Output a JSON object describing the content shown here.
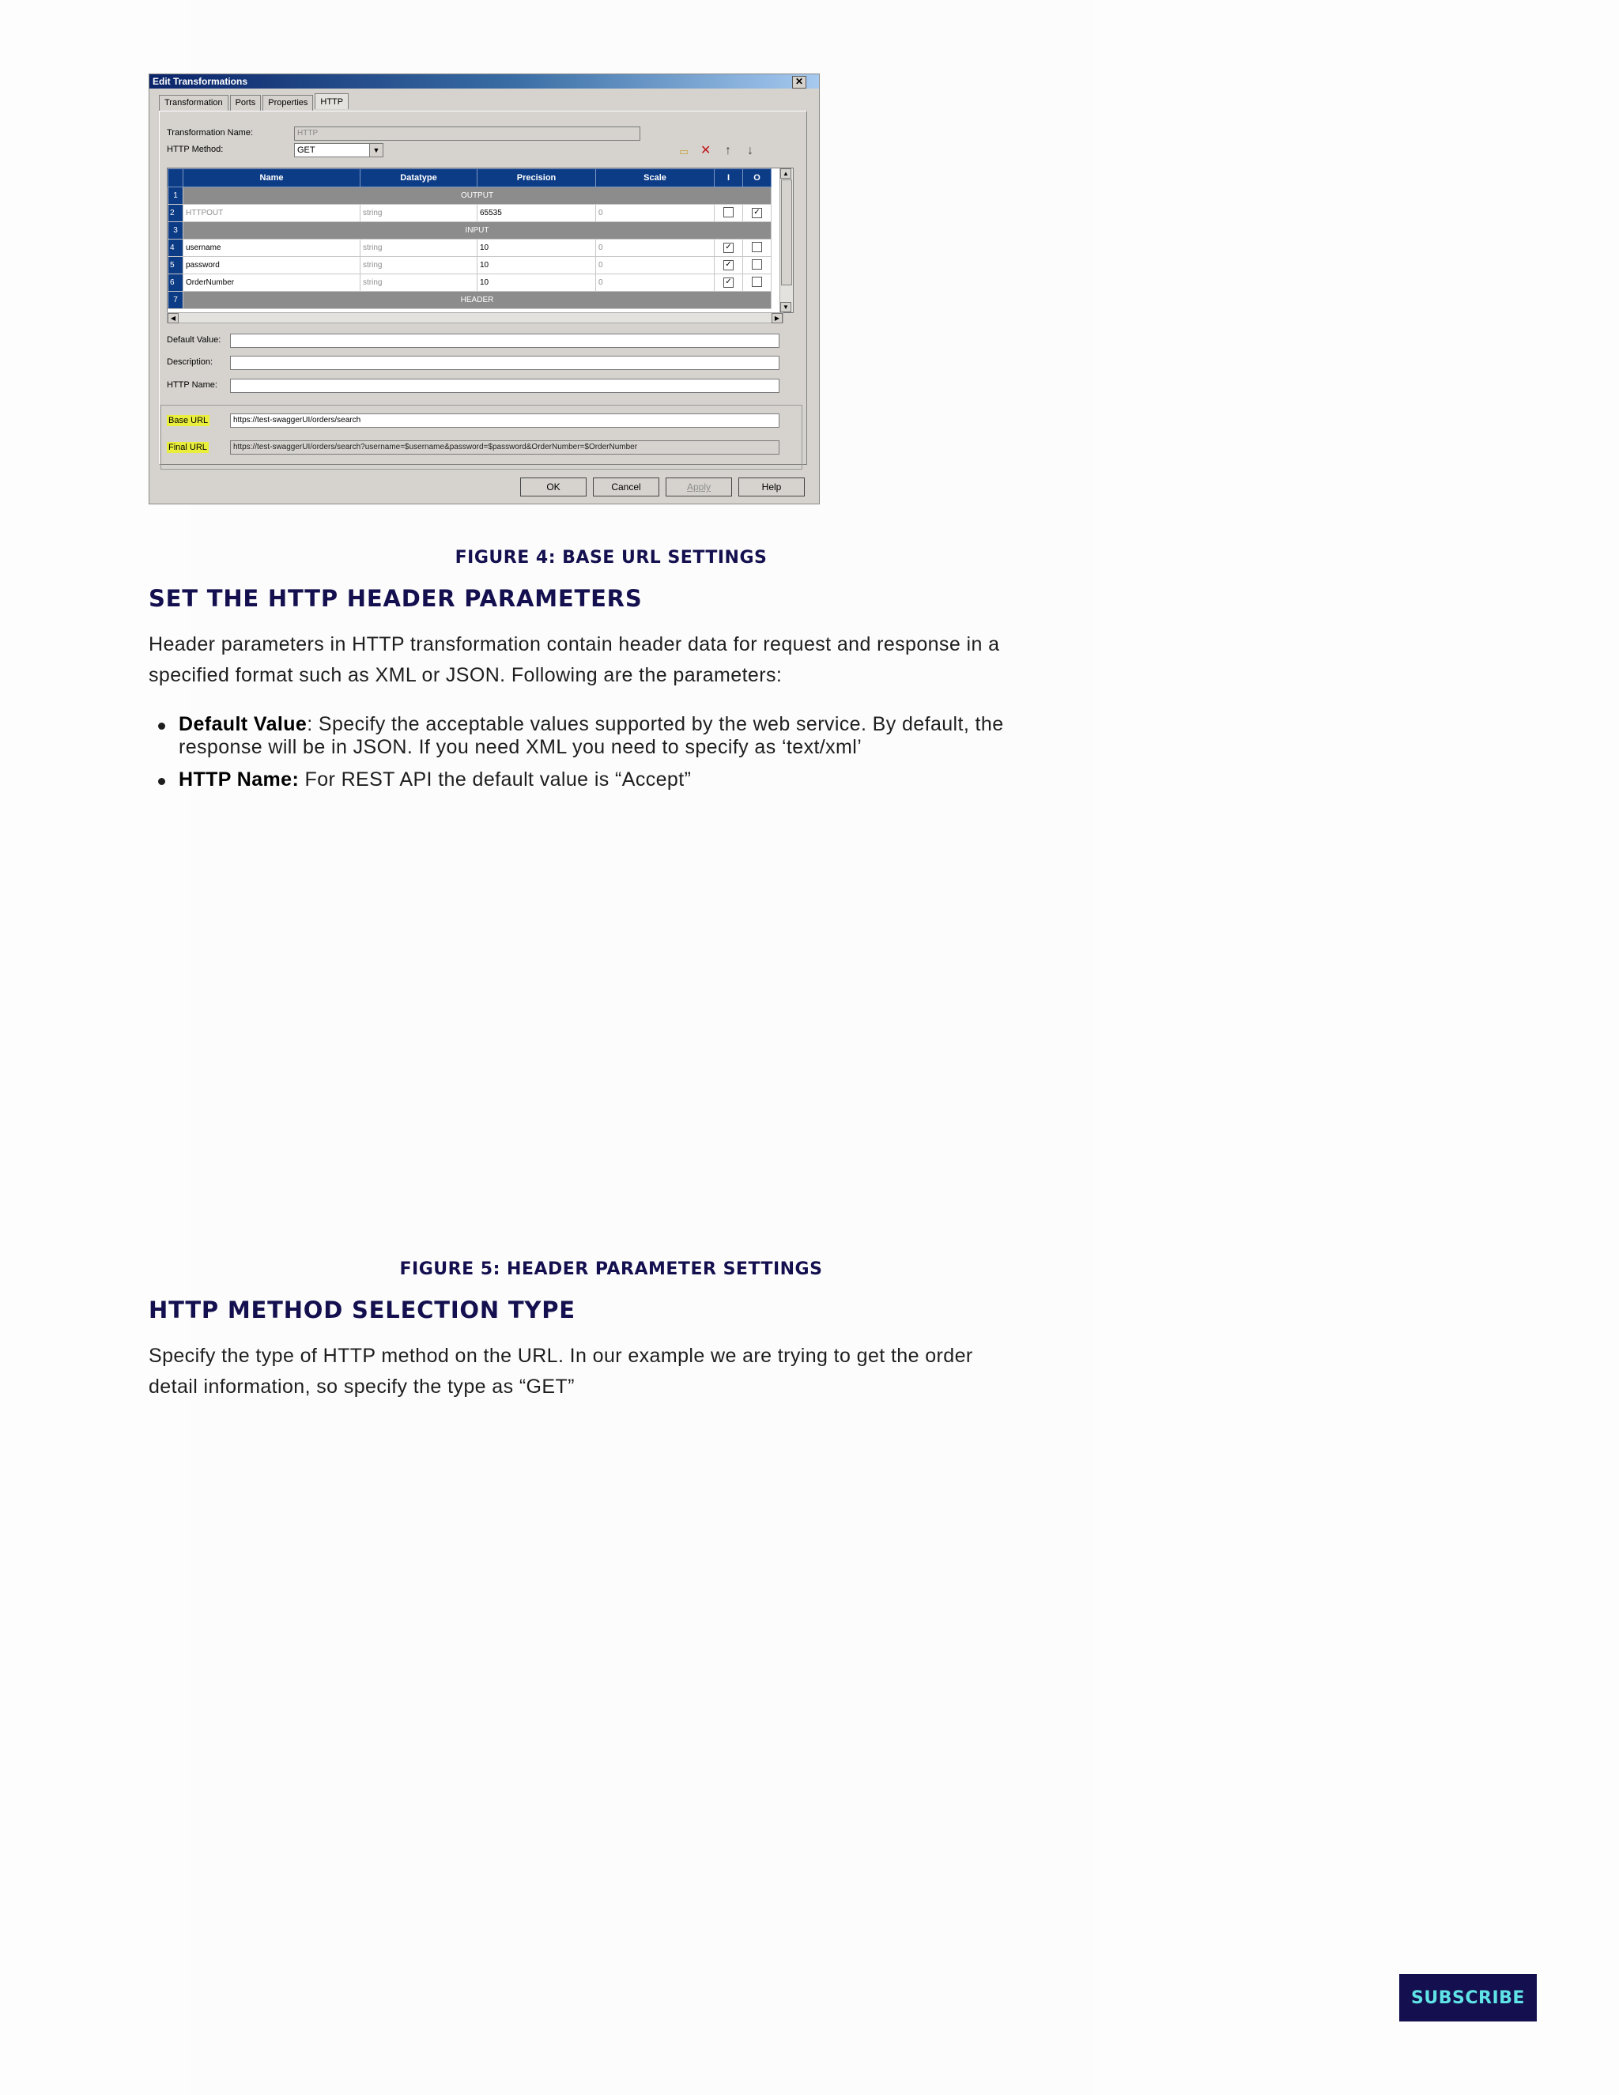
{
  "figure4": {
    "window_title": "Edit Transformations",
    "close_glyph": "✕",
    "tabs": [
      "Transformation",
      "Ports",
      "Properties",
      "HTTP"
    ],
    "transformation_name_label": "Transformation Name:",
    "transformation_name_value": "HTTP",
    "http_method_label": "HTTP Method:",
    "http_method_value": "GET",
    "columns": [
      "Name",
      "Datatype",
      "Precision",
      "Scale",
      "I",
      "O"
    ],
    "rows": [
      {
        "n": "1",
        "section": "OUTPUT"
      },
      {
        "n": "2",
        "name": "HTTPOUT",
        "datatype": "string",
        "precision": "65535",
        "scale": "0",
        "i": "",
        "o": "✓"
      },
      {
        "n": "3",
        "section": "INPUT"
      },
      {
        "n": "4",
        "name": "username",
        "datatype": "string",
        "precision": "10",
        "scale": "0",
        "i": "✓",
        "o": ""
      },
      {
        "n": "5",
        "name": "password",
        "datatype": "string",
        "precision": "10",
        "scale": "0",
        "i": "✓",
        "o": ""
      },
      {
        "n": "6",
        "name": "OrderNumber",
        "datatype": "string",
        "precision": "10",
        "scale": "0",
        "i": "✓",
        "o": ""
      },
      {
        "n": "7",
        "section": "HEADER"
      }
    ],
    "default_value_label": "Default Value:",
    "description_label": "Description:",
    "http_name_label": "HTTP Name:",
    "base_url_label": "Base URL",
    "base_url_value": "https://test-swaggerUI/orders/search",
    "final_url_label": "Final URL",
    "final_url_value": "https://test-swaggerUI/orders/search?username=$username&password=$password&OrderNumber=$OrderNumber",
    "buttons": {
      "ok": "OK",
      "cancel": "Cancel",
      "apply": "Apply",
      "help": "Help"
    }
  },
  "caption_fig4": "FIGURE 4: BASE URL SETTINGS",
  "section1": {
    "heading": "SET THE HTTP HEADER PARAMETERS",
    "para_line1": "Header parameters in HTTP transformation contain header data for request and response in a",
    "para_line2": "specified format such as XML or JSON. Following are the parameters:",
    "bullets": [
      {
        "term": "Default Value",
        "text_line1": ": Specify the acceptable values supported by the web service. By default, the",
        "text_line2": "response will be in JSON. If you need XML you need to specify as ‘text/xml’"
      },
      {
        "term": "HTTP Name:",
        "text_line1": " For REST API the default value is “Accept”"
      }
    ]
  },
  "caption_fig5": "FIGURE 5: HEADER PARAMETER SETTINGS",
  "section2": {
    "heading": "HTTP METHOD SELECTION TYPE",
    "para_line1": "Specify the type of HTTP method on the URL. In our example we are trying to get the order",
    "para_line2": "detail information, so specify the type as “GET”"
  },
  "subscribe_label": "SUBSCRIBE"
}
